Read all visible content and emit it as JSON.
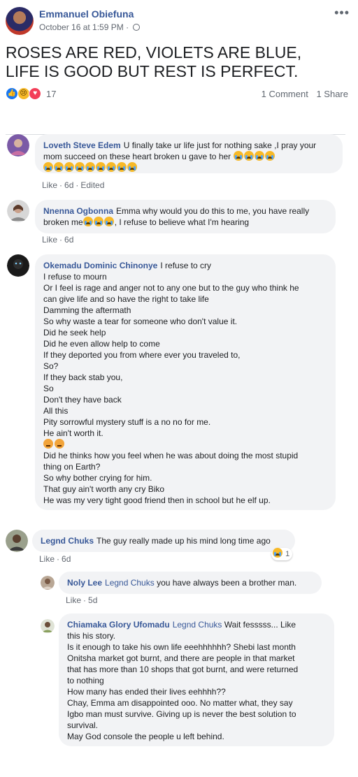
{
  "post": {
    "author": "Emmanuel Obiefuna",
    "timestamp": "October 16 at 1:59 PM",
    "more_label": "•••",
    "text_lines": [
      "ROSES ARE RED, VIOLETS ARE BLUE,",
      "LIFE IS GOOD BUT REST IS PERFECT."
    ],
    "reactions": [
      "like",
      "sad",
      "love"
    ],
    "reaction_count": "17",
    "comments_label": "1 Comment",
    "share_label": "1 Share"
  },
  "comments": [
    {
      "name": "Loveth Steve Edem",
      "text": "U finally take ur life just for nothing sake ,I pray your mom succeed on these heart broken u gave to her",
      "like": "Like",
      "time": "6d",
      "edited": "Edited"
    },
    {
      "name": "Nnenna Ogbonna",
      "text_a": "Emma why would you do this to me, you have really broken me",
      "text_b": ", I refuse to believe what I'm hearing",
      "like": "Like",
      "time": "6d"
    },
    {
      "name": "Okemadu Dominic Chinonye",
      "lines": [
        "I refuse to cry",
        "I refuse to mourn",
        "Or I feel is rage and anger not to any one but to the guy who think he",
        "can give life and so have the right to take life",
        "Damming the aftermath",
        "So why waste a tear for someone who don't value it.",
        "Did he seek help",
        "Did he even allow help to come",
        "If they deported you from where ever you traveled to,",
        "So?",
        "If they back stab you,",
        "So",
        "Don't they have back",
        "All this",
        "Pity sorrowful mystery stuff is a no no for me.",
        "He ain't worth it.",
        "",
        "Did he thinks how you feel when he was about doing the most stupid",
        "thing on Earth?",
        "So why bother crying for him.",
        "That guy ain't worth any cry Biko",
        "He was my very tight good friend then in school but he elf up."
      ]
    },
    {
      "name": "Legnd Chuks",
      "text": "The guy really made up his mind long time ago",
      "like": "Like",
      "time": "6d",
      "reaction_count": "1"
    }
  ],
  "replies": [
    {
      "name": "Noly Lee",
      "tag": "Legnd Chuks",
      "text": "you have always been a brother man.",
      "like": "Like",
      "time": "5d"
    },
    {
      "name": "Chiamaka Glory Ufomadu",
      "tag": "Legnd Chuks",
      "lines": [
        "Wait fesssss... Like",
        "this his story.",
        "Is it enough to take his own life eeehhhhhh? Shebi last month",
        "Onitsha market got burnt, and there are people in that market",
        "that has more than 10 shops that got burnt, and were returned",
        "to nothing",
        "How many has ended their lives eehhhh??",
        "Chay, Emma am disappointed ooo. No matter what, they say",
        "Igbo man must survive. Giving up is never the best solution to",
        "survival.",
        "May God console the people u left behind."
      ]
    }
  ],
  "colors": {
    "link_blue": "#385898",
    "bubble_bg": "#f2f3f5",
    "muted": "#616770"
  }
}
